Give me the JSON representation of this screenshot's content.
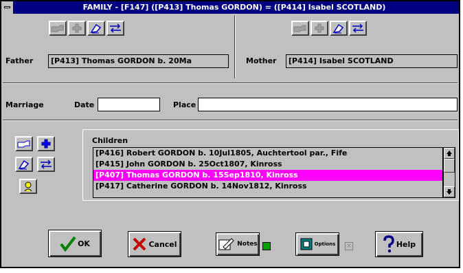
{
  "window": {
    "title": "FAMILY - [F147] ([P413] Thomas GORDON) = ([P414] Isabel SCOTLAND)"
  },
  "father": {
    "label": "Father",
    "value": "[P413] Thomas GORDON b. 20Ma"
  },
  "mother": {
    "label": "Mother",
    "value": "[P414] Isabel SCOTLAND"
  },
  "marriage": {
    "label": "Marriage",
    "date_label": "Date",
    "date_value": "",
    "place_label": "Place",
    "place_value": ""
  },
  "children": {
    "label": "Children",
    "items": [
      "[P416] Robert GORDON b. 10Jul1805, Auchtertool par., Fife",
      "[P415] John GORDON b. 25Oct1807, Kinross",
      "[P407] Thomas GORDON b. 15Sep1810, Kinross",
      "[P417] Catherine GORDON b. 14Nov1812, Kinross"
    ],
    "selected_index": 2
  },
  "buttons": {
    "ok": "OK",
    "cancel": "Cancel",
    "notes": "Notes",
    "options": "Options",
    "help": "Help"
  },
  "checkboxes": {
    "notes_checked": true,
    "options_checked": false
  },
  "colors": {
    "titlebar": "#000080",
    "selection": "#ff00ff",
    "dialog_bg": "#c0c0c0",
    "notes_check": "#00a000"
  }
}
